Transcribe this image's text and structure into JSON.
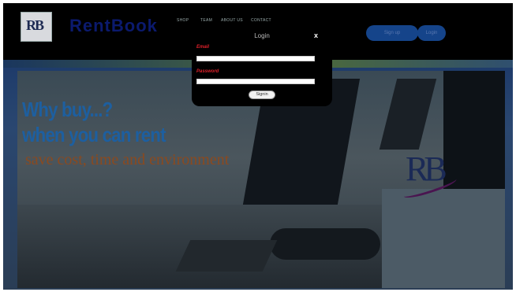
{
  "header": {
    "logo_text": "RB",
    "brand": "RentBook",
    "nav": [
      "SHOP",
      "TEAM",
      "ABOUT US",
      "CONTACT"
    ],
    "buttons": [
      "Sign up",
      "Login"
    ]
  },
  "hero": {
    "line1": "Why buy...?",
    "line2": "when you can rent",
    "line3": "save cost, time and environment",
    "logo_text": "RB"
  },
  "modal": {
    "title": "Login",
    "close": "x",
    "email_label": "Email",
    "password_label": "Password",
    "submit": "Signin"
  },
  "colors": {
    "brand_blue": "#0b1a6e",
    "headline_blue": "#1d5fa0",
    "tagline_brown": "#8a4a20",
    "label_red": "#e0202a"
  }
}
